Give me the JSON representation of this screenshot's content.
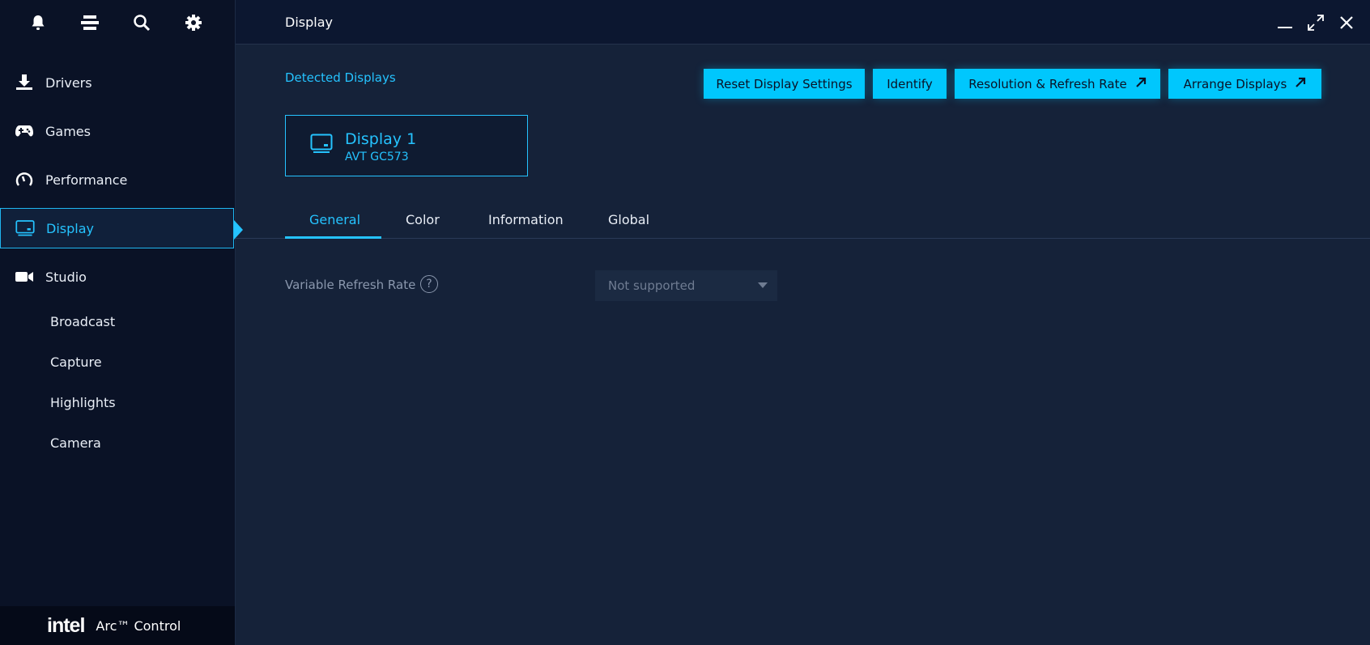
{
  "sidebar": {
    "top_icons": [
      "bell-icon",
      "menu-icon",
      "search-icon",
      "gear-icon"
    ],
    "items": [
      {
        "label": "Drivers",
        "icon": "download-icon"
      },
      {
        "label": "Games",
        "icon": "gamepad-icon"
      },
      {
        "label": "Performance",
        "icon": "gauge-icon"
      },
      {
        "label": "Display",
        "icon": "monitor-icon",
        "active": true
      },
      {
        "label": "Studio",
        "icon": "camera-icon"
      }
    ],
    "studio_sub": [
      "Broadcast",
      "Capture",
      "Highlights",
      "Camera"
    ]
  },
  "brand": {
    "logo": "intel",
    "product": "Arc™ Control"
  },
  "header": {
    "title": "Display"
  },
  "main": {
    "detected_label": "Detected Displays",
    "buttons": {
      "reset": "Reset Display Settings",
      "identify": "Identify",
      "resolution": "Resolution & Refresh Rate",
      "arrange": "Arrange Displays"
    },
    "display_card": {
      "name": "Display 1",
      "model": "AVT GC573"
    },
    "tabs": [
      "General",
      "Color",
      "Information",
      "Global"
    ],
    "active_tab": "General",
    "vrr": {
      "label": "Variable Refresh Rate",
      "help": "?",
      "value": "Not supported"
    }
  },
  "colors": {
    "accent": "#25c3ff",
    "button": "#00c7fd",
    "background": "#152239",
    "sidebar": "#0a1226"
  }
}
